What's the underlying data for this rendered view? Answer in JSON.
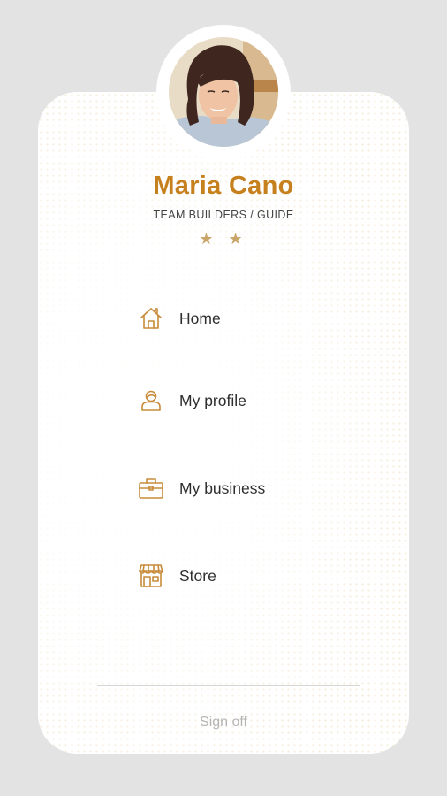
{
  "user": {
    "name": "Maria Cano",
    "role": "TEAM BUILDERS / GUIDE",
    "stars": "★ ★",
    "star_count": 2
  },
  "menu": {
    "items": [
      {
        "label": "Home",
        "icon": "home-icon"
      },
      {
        "label": "My profile",
        "icon": "user-icon"
      },
      {
        "label": "My business",
        "icon": "briefcase-icon"
      },
      {
        "label": "Store",
        "icon": "store-icon"
      }
    ]
  },
  "footer": {
    "sign_off_label": "Sign off"
  },
  "colors": {
    "accent": "#c7801e",
    "icon": "#c78b3a",
    "background": "#e3e3e3",
    "card": "#ffffff"
  }
}
